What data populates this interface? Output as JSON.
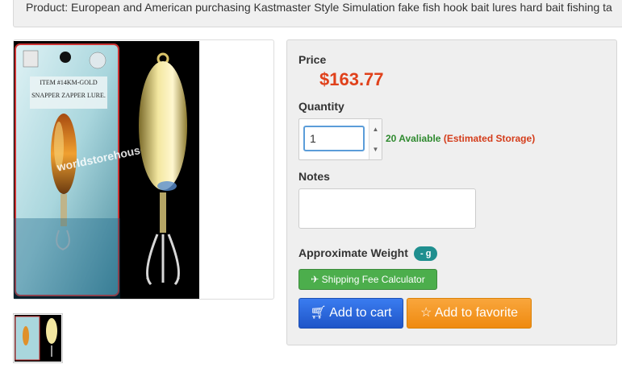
{
  "product_title": "Product: European and American purchasing Kastmaster Style Simulation fake fish hook bait lures hard bait fishing ta",
  "image": {
    "package_item_text": "ITEM #14KM-GOLD",
    "package_name_text": "SNAPPER ZAPPER LURE.",
    "watermark": "worldstorehouse"
  },
  "price": {
    "label": "Price",
    "value": "$163.77"
  },
  "quantity": {
    "label": "Quantity",
    "value": "1",
    "available_text": "20 Avaliable",
    "estimated_text": "(Estimated Storage)"
  },
  "notes": {
    "label": "Notes",
    "value": ""
  },
  "weight": {
    "label": "Approximate Weight",
    "badge": "- g"
  },
  "buttons": {
    "shipping_calc": "Shipping Fee Calculator",
    "add_to_cart": "Add to cart",
    "add_to_favorite": "Add to favorite"
  },
  "colors": {
    "price": "#e0411b",
    "available": "#2f8a2f",
    "estimated": "#d43c1a",
    "cart_button": "#2a66d9",
    "favorite_button": "#f19a2a",
    "shipping_button": "#4cae4c",
    "weight_badge": "#1f8f8f"
  },
  "icons": {
    "shipping": "plane-icon",
    "cart": "cart-icon",
    "favorite": "star-icon",
    "spinner_up": "chevron-up-icon",
    "spinner_down": "chevron-down-icon"
  }
}
